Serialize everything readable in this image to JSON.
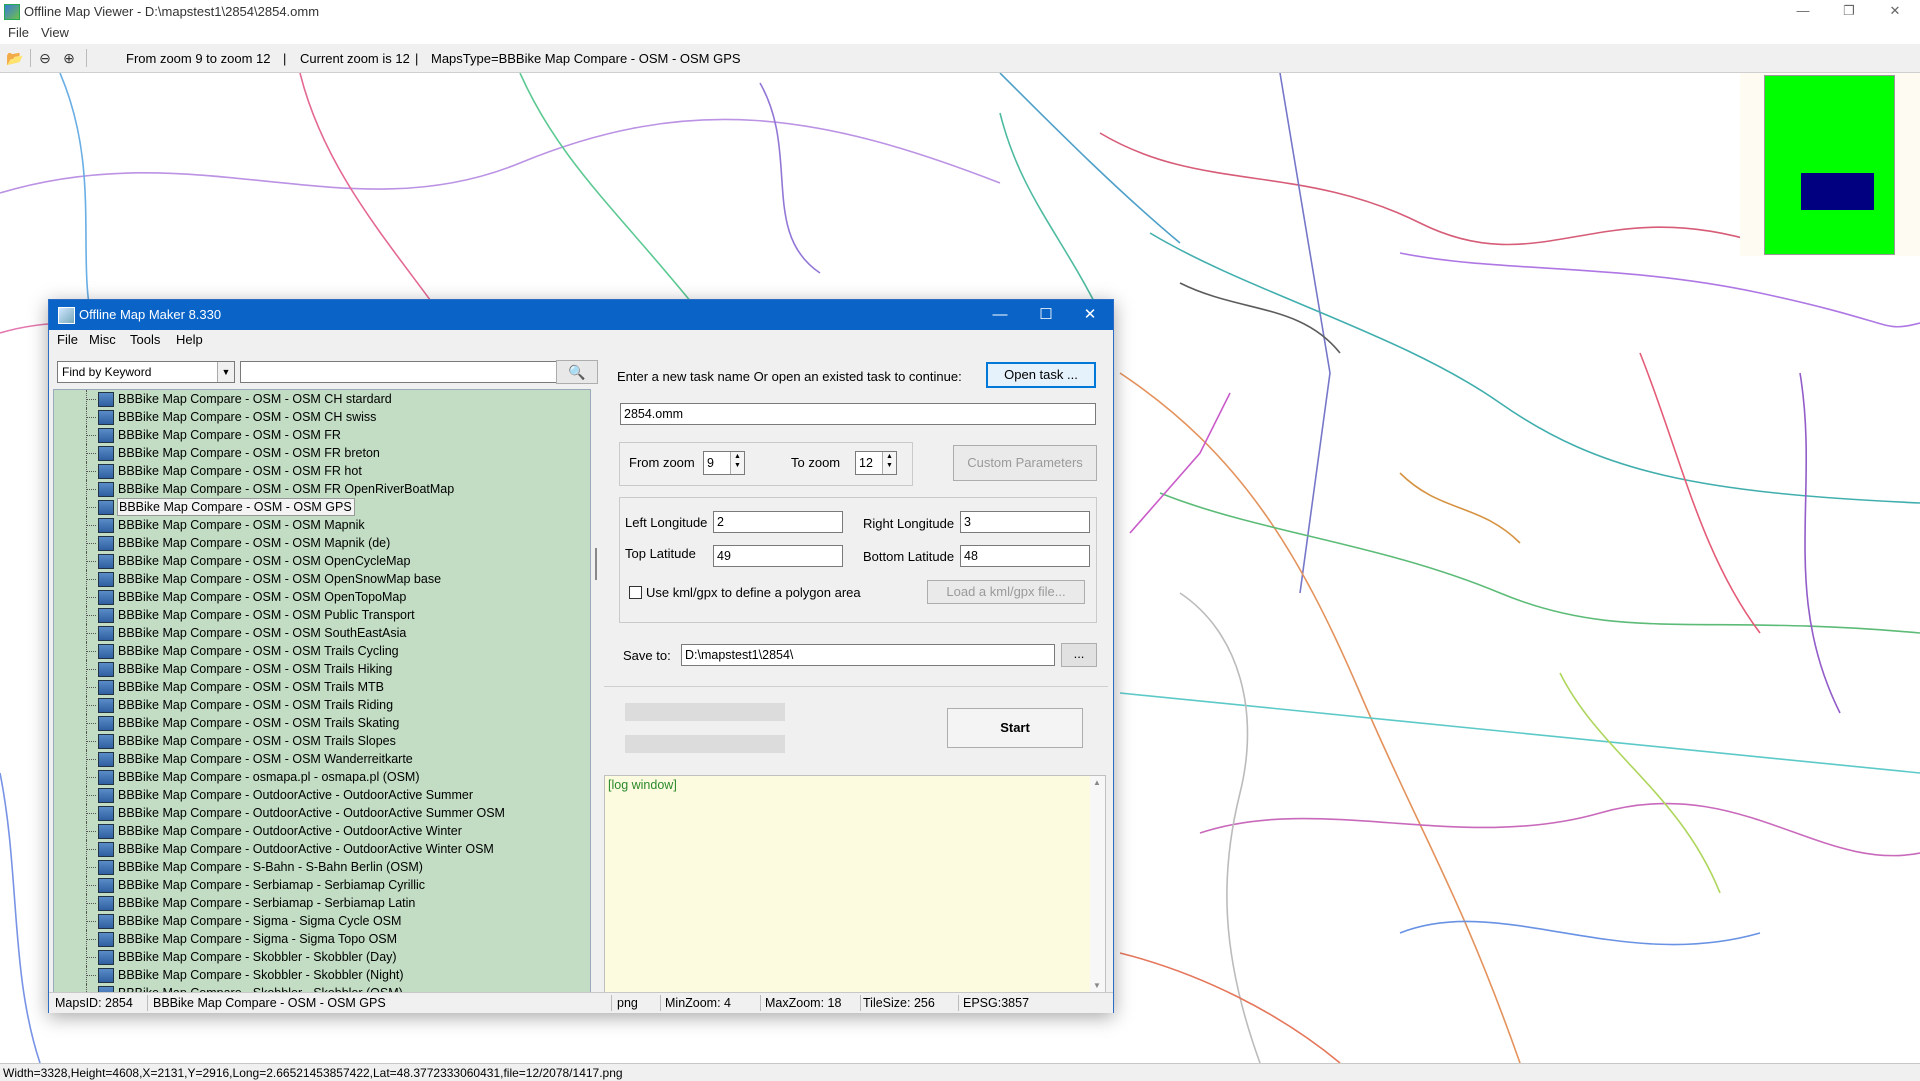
{
  "main_window": {
    "title": "Offline Map Viewer - D:\\mapstest1\\2854\\2854.omm",
    "menu": [
      "File",
      "View"
    ],
    "toolbar": {
      "zoom_range": "From zoom 9 to zoom 12",
      "current_zoom": "Current zoom is 12",
      "maps_type": "MapsType=BBBike Map Compare - OSM - OSM GPS",
      "sep": "|"
    },
    "status": "Width=3328,Height=4608,X=2131,Y=2916,Long=2.66521453857422,Lat=48.3772333060431,file=12/2078/1417.png"
  },
  "dialog": {
    "title": "Offline Map Maker 8.330",
    "menu": [
      "File",
      "Misc",
      "Tools",
      "Help"
    ],
    "search": {
      "mode": "Find by Keyword",
      "query": ""
    },
    "tree_items": [
      "BBBike Map Compare - OSM - OSM CH stardard",
      "BBBike Map Compare - OSM - OSM CH swiss",
      "BBBike Map Compare - OSM - OSM FR",
      "BBBike Map Compare - OSM - OSM FR breton",
      "BBBike Map Compare - OSM - OSM FR hot",
      "BBBike Map Compare - OSM - OSM FR OpenRiverBoatMap",
      "BBBike Map Compare - OSM - OSM GPS",
      "BBBike Map Compare - OSM - OSM Mapnik",
      "BBBike Map Compare - OSM - OSM Mapnik (de)",
      "BBBike Map Compare - OSM - OSM OpenCycleMap",
      "BBBike Map Compare - OSM - OSM OpenSnowMap base",
      "BBBike Map Compare - OSM - OSM OpenTopoMap",
      "BBBike Map Compare - OSM - OSM Public Transport",
      "BBBike Map Compare - OSM - OSM SouthEastAsia",
      "BBBike Map Compare - OSM - OSM Trails Cycling",
      "BBBike Map Compare - OSM - OSM Trails Hiking",
      "BBBike Map Compare - OSM - OSM Trails MTB",
      "BBBike Map Compare - OSM - OSM Trails Riding",
      "BBBike Map Compare - OSM - OSM Trails Skating",
      "BBBike Map Compare - OSM - OSM Trails Slopes",
      "BBBike Map Compare - OSM - OSM Wanderreitkarte",
      "BBBike Map Compare - osmapa.pl - osmapa.pl (OSM)",
      "BBBike Map Compare - OutdoorActive - OutdoorActive Summer",
      "BBBike Map Compare - OutdoorActive - OutdoorActive Summer OSM",
      "BBBike Map Compare - OutdoorActive - OutdoorActive Winter",
      "BBBike Map Compare - OutdoorActive - OutdoorActive Winter OSM",
      "BBBike Map Compare - S-Bahn - S-Bahn Berlin (OSM)",
      "BBBike Map Compare - Serbiamap - Serbiamap Cyrillic",
      "BBBike Map Compare - Serbiamap - Serbiamap Latin",
      "BBBike Map Compare - Sigma - Sigma Cycle OSM",
      "BBBike Map Compare - Sigma - Sigma Topo OSM",
      "BBBike Map Compare - Skobbler - Skobbler (Day)",
      "BBBike Map Compare - Skobbler - Skobbler (Night)",
      "BBBike Map Compare - Skobbler - Skobbler (OSM)"
    ],
    "selected_index": 6,
    "task_prompt": "Enter a new task name Or open an existed task to continue:",
    "open_task_label": "Open task ...",
    "task_name": "2854.omm",
    "from_zoom_label": "From zoom",
    "from_zoom": "9",
    "to_zoom_label": "To zoom",
    "to_zoom": "12",
    "custom_params_label": "Custom Parameters",
    "left_lon_label": "Left Longitude",
    "left_lon": "2",
    "right_lon_label": "Right Longitude",
    "right_lon": "3",
    "top_lat_label": "Top Latitude",
    "top_lat": "49",
    "bottom_lat_label": "Bottom Latitude",
    "bottom_lat": "48",
    "kml_checkbox_label": "Use kml/gpx to define a polygon area",
    "load_kml_label": "Load a kml/gpx file...",
    "save_to_label": "Save to:",
    "save_to": "D:\\mapstest1\\2854\\",
    "browse_label": "...",
    "start_label": "Start",
    "log_text": "[log window]",
    "status": {
      "maps_id": "MapsID: 2854",
      "map_name": "BBBike Map Compare - OSM - OSM GPS",
      "format": "png",
      "min_zoom": "MinZoom: 4",
      "max_zoom": "MaxZoom: 18",
      "tile_size": "TileSize: 256",
      "epsg": "EPSG:3857"
    }
  },
  "colors": {
    "dialog_title": "#0a64c8",
    "tree_bg": "#c2ddc4",
    "log_bg": "#fcfbe0",
    "minimap_bg": "#00ff00",
    "minimap_view": "#000080"
  }
}
